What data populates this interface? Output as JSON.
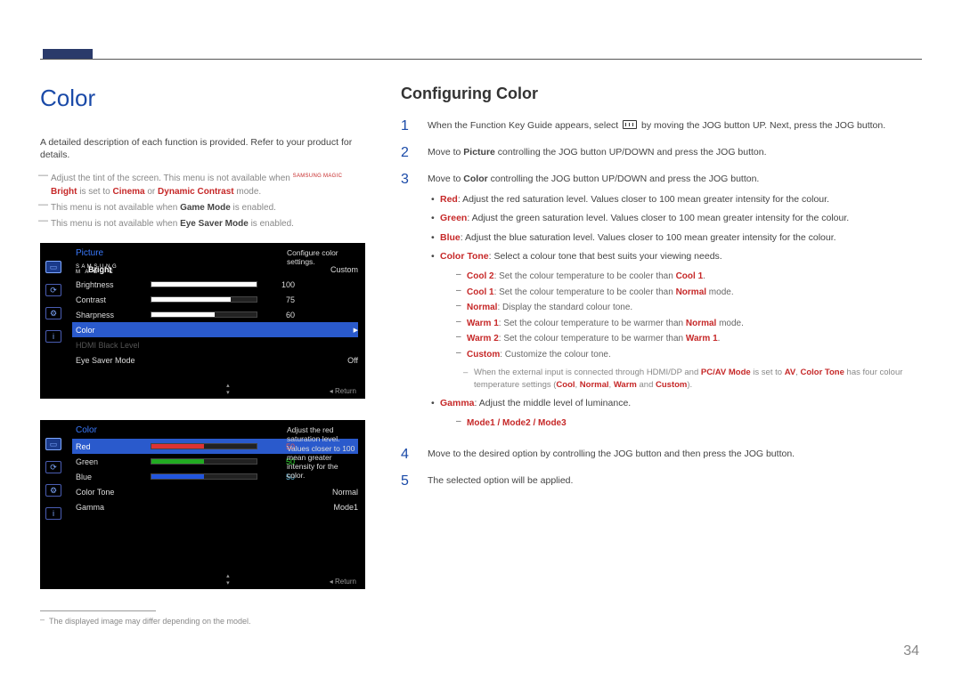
{
  "page": {
    "number": "34"
  },
  "left": {
    "heading": "Color",
    "intro": "A detailed description of each function is provided. Refer to your product for details.",
    "notes": [
      {
        "pre": "Adjust the tint of the screen. This menu is not available when ",
        "magic": "SAMSUNG MAGIC Bright",
        "post": " is set to ",
        "r1": "Cinema",
        "mid": " or ",
        "r2": "Dynamic Contrast",
        "tail": " mode."
      },
      {
        "pre": "This menu is not available when ",
        "bold": "Game Mode",
        "post": " is enabled."
      },
      {
        "pre": "This menu is not available when ",
        "bold": "Eye Saver Mode",
        "post": " is enabled."
      }
    ],
    "footnote": "The displayed image may differ depending on the model."
  },
  "osd1": {
    "title": "Picture",
    "hint": "Configure color settings.",
    "return": "Return",
    "rows": {
      "magic": {
        "label": "Bright",
        "value": "Custom"
      },
      "brightness": {
        "label": "Brightness",
        "value": "100",
        "pct": 100
      },
      "contrast": {
        "label": "Contrast",
        "value": "75",
        "pct": 75
      },
      "sharpness": {
        "label": "Sharpness",
        "value": "60",
        "pct": 60
      },
      "color": {
        "label": "Color"
      },
      "hdmi": {
        "label": "HDMI Black Level"
      },
      "eyesaver": {
        "label": "Eye Saver Mode",
        "value": "Off"
      }
    }
  },
  "osd2": {
    "title": "Color",
    "hint": "Adjust the red saturation level. Values closer to 100 mean greater intensity for the color.",
    "return": "Return",
    "rows": {
      "red": {
        "label": "Red",
        "value": "50",
        "pct": 50
      },
      "green": {
        "label": "Green",
        "value": "50",
        "pct": 50
      },
      "blue": {
        "label": "Blue",
        "value": "50",
        "pct": 50
      },
      "tone": {
        "label": "Color Tone",
        "value": "Normal"
      },
      "gamma": {
        "label": "Gamma",
        "value": "Mode1"
      }
    }
  },
  "right": {
    "heading": "Configuring Color",
    "steps": {
      "s1": {
        "pre": "When the Function Key Guide appears, select ",
        "post": " by moving the JOG button UP. Next, press the JOG button."
      },
      "s2": {
        "a": "Move to ",
        "b": "Picture",
        "c": " controlling the JOG button UP/DOWN and press the JOG button."
      },
      "s3": {
        "a": "Move to ",
        "b": "Color",
        "c": " controlling the JOG button UP/DOWN and press the JOG button.",
        "red": {
          "k": "Red",
          "t": ": Adjust the red saturation level. Values closer to 100 mean greater intensity for the colour."
        },
        "green": {
          "k": "Green",
          "t": ": Adjust the green saturation level. Values closer to 100 mean greater intensity for the colour."
        },
        "blue": {
          "k": "Blue",
          "t": ": Adjust the blue saturation level. Values closer to 100 mean greater intensity for the colour."
        },
        "tone": {
          "k": "Color Tone",
          "t": ": Select a colour tone that best suits your viewing needs."
        },
        "cool2": {
          "k": "Cool 2",
          "t": ": Set the colour temperature to be cooler than ",
          "r": "Cool 1",
          "tail": "."
        },
        "cool1": {
          "k": "Cool 1",
          "t": ": Set the colour temperature to be cooler than ",
          "r": "Normal",
          "tail": " mode."
        },
        "normal": {
          "k": "Normal",
          "t": ": Display the standard colour tone."
        },
        "warm1": {
          "k": "Warm 1",
          "t": ": Set the colour temperature to be warmer than ",
          "r": "Normal",
          "tail": " mode."
        },
        "warm2": {
          "k": "Warm 2",
          "t": ": Set the colour temperature to be warmer than ",
          "r": "Warm 1",
          "tail": "."
        },
        "custom": {
          "k": "Custom",
          "t": ": Customize the colour tone."
        },
        "pcav": {
          "a": "When the external input is connected through HDMI/DP and ",
          "b": "PC/AV Mode",
          "c": " is set to ",
          "d": "AV",
          "e": ", ",
          "f": "Color Tone",
          "g": " has four colour temperature settings (",
          "h": "Cool",
          "i": ", ",
          "j": "Normal",
          "k": ", ",
          "l": "Warm",
          "m": " and ",
          "n": "Custom",
          "o": ")."
        },
        "gamma": {
          "k": "Gamma",
          "t": ": Adjust the middle level of luminance."
        },
        "gammamodes": "Mode1 / Mode2 / Mode3"
      },
      "s4": "Move to the desired option by controlling the JOG button and then press the JOG button.",
      "s5": "The selected option will be applied."
    }
  }
}
